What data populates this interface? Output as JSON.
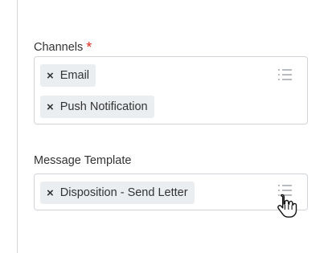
{
  "channels": {
    "label": "Channels",
    "required_mark": "*",
    "selected": [
      {
        "label": "Email",
        "remove_icon": "×"
      },
      {
        "label": "Push Notification",
        "remove_icon": "×"
      }
    ],
    "menu_icon": "list-icon"
  },
  "message_template": {
    "label": "Message Template",
    "selected": [
      {
        "label": "Disposition - Send Letter",
        "remove_icon": "×"
      }
    ],
    "menu_icon": "list-icon"
  },
  "colors": {
    "required": "#de2c1e",
    "pill_bg": "#ebeef1",
    "border": "#d0d4d8",
    "icon": "#9aa0a6"
  },
  "cursor": "hand-pointer"
}
